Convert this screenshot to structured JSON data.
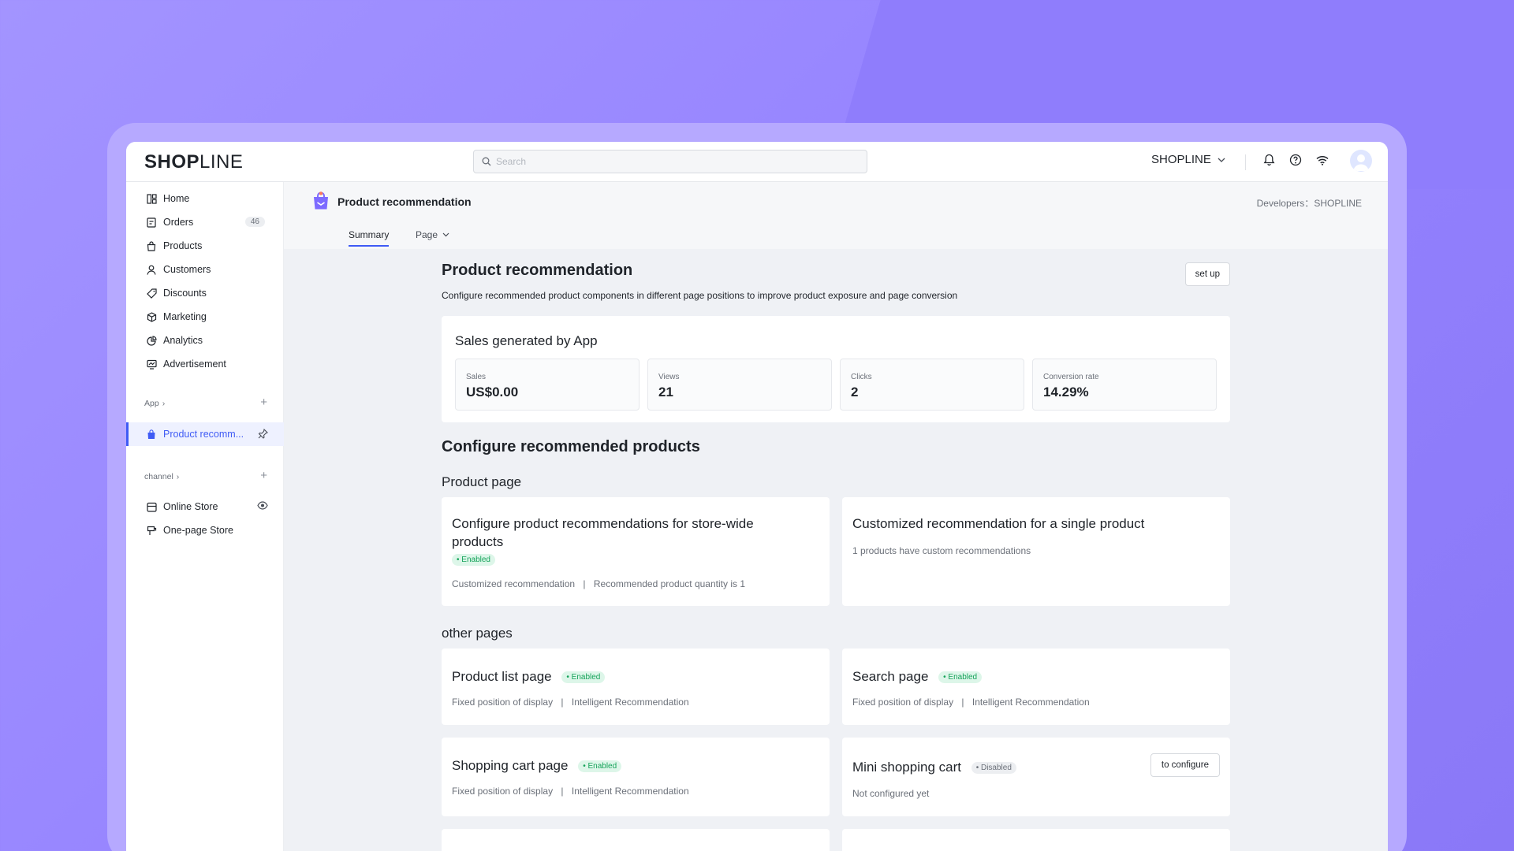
{
  "logo": {
    "part1": "SHOP",
    "part2": "LINE"
  },
  "search": {
    "placeholder": "Search"
  },
  "header": {
    "store_name": "SHOPLINE"
  },
  "sidebar": {
    "items": [
      {
        "label": "Home"
      },
      {
        "label": "Orders",
        "badge": "46"
      },
      {
        "label": "Products"
      },
      {
        "label": "Customers"
      },
      {
        "label": "Discounts"
      },
      {
        "label": "Marketing"
      },
      {
        "label": "Analytics"
      },
      {
        "label": "Advertisement"
      }
    ],
    "app_section": {
      "label": "App",
      "chevron": "›"
    },
    "app_item": {
      "label": "Product recomm..."
    },
    "channel_section": {
      "label": "channel",
      "chevron": "›"
    },
    "channel_items": [
      {
        "label": "Online Store"
      },
      {
        "label": "One-page Store"
      }
    ],
    "plus_symbol": "+"
  },
  "page_header": {
    "title": "Product recommendation",
    "developer_label": "Developers：",
    "developer_name": "SHOPLINE",
    "tabs": [
      {
        "label": "Summary"
      },
      {
        "label": "Page"
      }
    ]
  },
  "main": {
    "title": "Product recommendation",
    "setup_button": "set up",
    "description": "Configure recommended product components in different page positions to improve product exposure and page conversion"
  },
  "sales": {
    "title": "Sales generated by App",
    "stats": [
      {
        "label": "Sales",
        "value": "US$0.00"
      },
      {
        "label": "Views",
        "value": "21"
      },
      {
        "label": "Clicks",
        "value": "2"
      },
      {
        "label": "Conversion rate",
        "value": "14.29%"
      }
    ]
  },
  "configure": {
    "title": "Configure recommended products",
    "product_page_title": "Product page",
    "storewide_card": {
      "title_line1": "Configure product recommendations for store-wide",
      "title_line2": "products",
      "status": "Enabled",
      "detail_left": "Customized recommendation",
      "detail_sep": "|",
      "detail_right": "Recommended product quantity is 1"
    },
    "single_card": {
      "title": "Customized recommendation for a single product",
      "detail": "1 products have custom recommendations"
    },
    "other_pages_title": "other pages",
    "other_cards": [
      {
        "title": "Product list page",
        "status": "Enabled",
        "detail_left": "Fixed position of display",
        "detail_sep": "|",
        "detail_right": "Intelligent Recommendation"
      },
      {
        "title": "Search page",
        "status": "Enabled",
        "detail_left": "Fixed position of display",
        "detail_sep": "|",
        "detail_right": "Intelligent Recommendation"
      },
      {
        "title": "Shopping cart page",
        "status": "Enabled",
        "detail_left": "Fixed position of display",
        "detail_sep": "|",
        "detail_right": "Intelligent Recommendation"
      },
      {
        "title": "Mini shopping cart",
        "status": "Disabled",
        "detail": "Not configured yet",
        "button": "to configure"
      }
    ]
  },
  "colors": {
    "accent": "#3f5bf5",
    "enabled": "#16a35a",
    "background": "#9583ff"
  }
}
